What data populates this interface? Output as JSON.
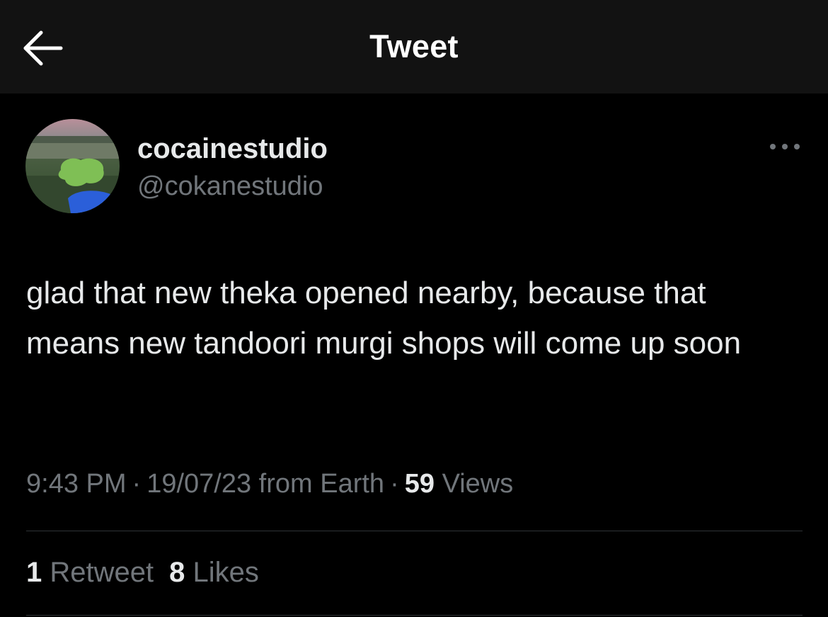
{
  "header": {
    "title": "Tweet",
    "back_icon": "arrow-left-icon"
  },
  "tweet": {
    "author": {
      "display_name": "cocainestudio",
      "handle": "@cokanestudio",
      "avatar": "avatar-image"
    },
    "more_icon": "ellipsis-icon",
    "text": "glad that new theka opened nearby, because that means new tandoori murgi shops will come up soon",
    "meta": {
      "time": "9:43 PM",
      "separator": "·",
      "date": "19/07/23",
      "source": "from Earth",
      "views_count": "59",
      "views_label": "Views"
    },
    "stats": {
      "retweets_count": "1",
      "retweets_label": "Retweet",
      "likes_count": "8",
      "likes_label": "Likes"
    }
  },
  "colors": {
    "background": "#000000",
    "topbar": "#121212",
    "primary_text": "#e7e9ea",
    "secondary_text": "#71767b",
    "divider": "#2f3336"
  }
}
